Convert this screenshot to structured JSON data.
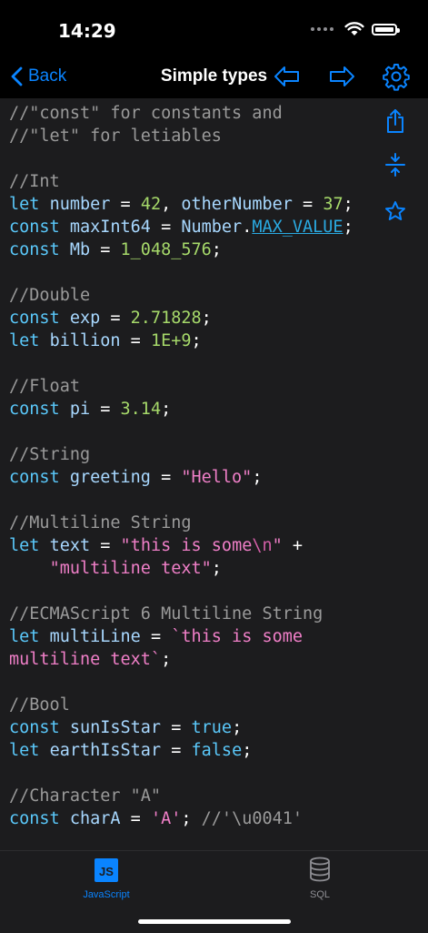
{
  "status": {
    "time": "14:29"
  },
  "nav": {
    "back_label": "Back",
    "title": "Simple types"
  },
  "colors": {
    "accent": "#0a84ff",
    "background": "#1c1c1e"
  },
  "code_lines": [
    [
      {
        "t": "//\"const\" for constants and",
        "c": "cm"
      }
    ],
    [
      {
        "t": "//\"let\" for letiables",
        "c": "cm"
      }
    ],
    [],
    [
      {
        "t": "//Int",
        "c": "cm"
      }
    ],
    [
      {
        "t": "let ",
        "c": "kw"
      },
      {
        "t": "number",
        "c": "id"
      },
      {
        "t": " = ",
        "c": ""
      },
      {
        "t": "42",
        "c": "nm"
      },
      {
        "t": ", ",
        "c": ""
      },
      {
        "t": "otherNumber",
        "c": "id"
      },
      {
        "t": " = ",
        "c": ""
      },
      {
        "t": "37",
        "c": "nm"
      },
      {
        "t": ";",
        "c": ""
      }
    ],
    [
      {
        "t": "const ",
        "c": "kw"
      },
      {
        "t": "maxInt64",
        "c": "id"
      },
      {
        "t": " = ",
        "c": ""
      },
      {
        "t": "Number",
        "c": "id"
      },
      {
        "t": ".",
        "c": ""
      },
      {
        "t": "MAX_VALUE",
        "c": "lk"
      },
      {
        "t": ";",
        "c": ""
      }
    ],
    [
      {
        "t": "const ",
        "c": "kw"
      },
      {
        "t": "Mb",
        "c": "id"
      },
      {
        "t": " = ",
        "c": ""
      },
      {
        "t": "1_048_576",
        "c": "nm"
      },
      {
        "t": ";",
        "c": ""
      }
    ],
    [],
    [
      {
        "t": "//Double",
        "c": "cm"
      }
    ],
    [
      {
        "t": "const ",
        "c": "kw"
      },
      {
        "t": "exp",
        "c": "id"
      },
      {
        "t": " = ",
        "c": ""
      },
      {
        "t": "2.71828",
        "c": "nm"
      },
      {
        "t": ";",
        "c": ""
      }
    ],
    [
      {
        "t": "let ",
        "c": "kw"
      },
      {
        "t": "billion",
        "c": "id"
      },
      {
        "t": " = ",
        "c": ""
      },
      {
        "t": "1E+9",
        "c": "nm"
      },
      {
        "t": ";",
        "c": ""
      }
    ],
    [],
    [
      {
        "t": "//Float",
        "c": "cm"
      }
    ],
    [
      {
        "t": "const ",
        "c": "kw"
      },
      {
        "t": "pi",
        "c": "id"
      },
      {
        "t": " = ",
        "c": ""
      },
      {
        "t": "3.14",
        "c": "nm"
      },
      {
        "t": ";",
        "c": ""
      }
    ],
    [],
    [
      {
        "t": "//String",
        "c": "cm"
      }
    ],
    [
      {
        "t": "const ",
        "c": "kw"
      },
      {
        "t": "greeting",
        "c": "id"
      },
      {
        "t": " = ",
        "c": ""
      },
      {
        "t": "\"Hello\"",
        "c": "st"
      },
      {
        "t": ";",
        "c": ""
      }
    ],
    [],
    [
      {
        "t": "//Multiline String",
        "c": "cm"
      }
    ],
    [
      {
        "t": "let ",
        "c": "kw"
      },
      {
        "t": "text",
        "c": "id"
      },
      {
        "t": " = ",
        "c": ""
      },
      {
        "t": "\"this is some",
        "c": "st"
      },
      {
        "t": "\\n",
        "c": "esc"
      },
      {
        "t": "\"",
        "c": "st"
      },
      {
        "t": " +",
        "c": ""
      }
    ],
    [
      {
        "t": "    ",
        "c": ""
      },
      {
        "t": "\"multiline text\"",
        "c": "st"
      },
      {
        "t": ";",
        "c": ""
      }
    ],
    [],
    [
      {
        "t": "//ECMAScript 6 Multiline String",
        "c": "cm"
      }
    ],
    [
      {
        "t": "let ",
        "c": "kw"
      },
      {
        "t": "multiLine",
        "c": "id"
      },
      {
        "t": " = ",
        "c": ""
      },
      {
        "t": "`this is some",
        "c": "st"
      }
    ],
    [
      {
        "t": "multiline text`",
        "c": "st"
      },
      {
        "t": ";",
        "c": ""
      }
    ],
    [],
    [
      {
        "t": "//Bool",
        "c": "cm"
      }
    ],
    [
      {
        "t": "const ",
        "c": "kw"
      },
      {
        "t": "sunIsStar",
        "c": "id"
      },
      {
        "t": " = ",
        "c": ""
      },
      {
        "t": "true",
        "c": "kw"
      },
      {
        "t": ";",
        "c": ""
      }
    ],
    [
      {
        "t": "let ",
        "c": "kw"
      },
      {
        "t": "earthIsStar",
        "c": "id"
      },
      {
        "t": " = ",
        "c": ""
      },
      {
        "t": "false",
        "c": "kw"
      },
      {
        "t": ";",
        "c": ""
      }
    ],
    [],
    [
      {
        "t": "//Character \"A\"",
        "c": "cm"
      }
    ],
    [
      {
        "t": "const ",
        "c": "kw"
      },
      {
        "t": "charA",
        "c": "id"
      },
      {
        "t": " = ",
        "c": ""
      },
      {
        "t": "'A'",
        "c": "st"
      },
      {
        "t": "; ",
        "c": ""
      },
      {
        "t": "//'\\u0041'",
        "c": "cm"
      }
    ]
  ],
  "tabs": [
    {
      "label": "JavaScript",
      "icon": "js-icon",
      "badge": "JS",
      "active": true
    },
    {
      "label": "SQL",
      "icon": "database-icon",
      "active": false
    }
  ]
}
